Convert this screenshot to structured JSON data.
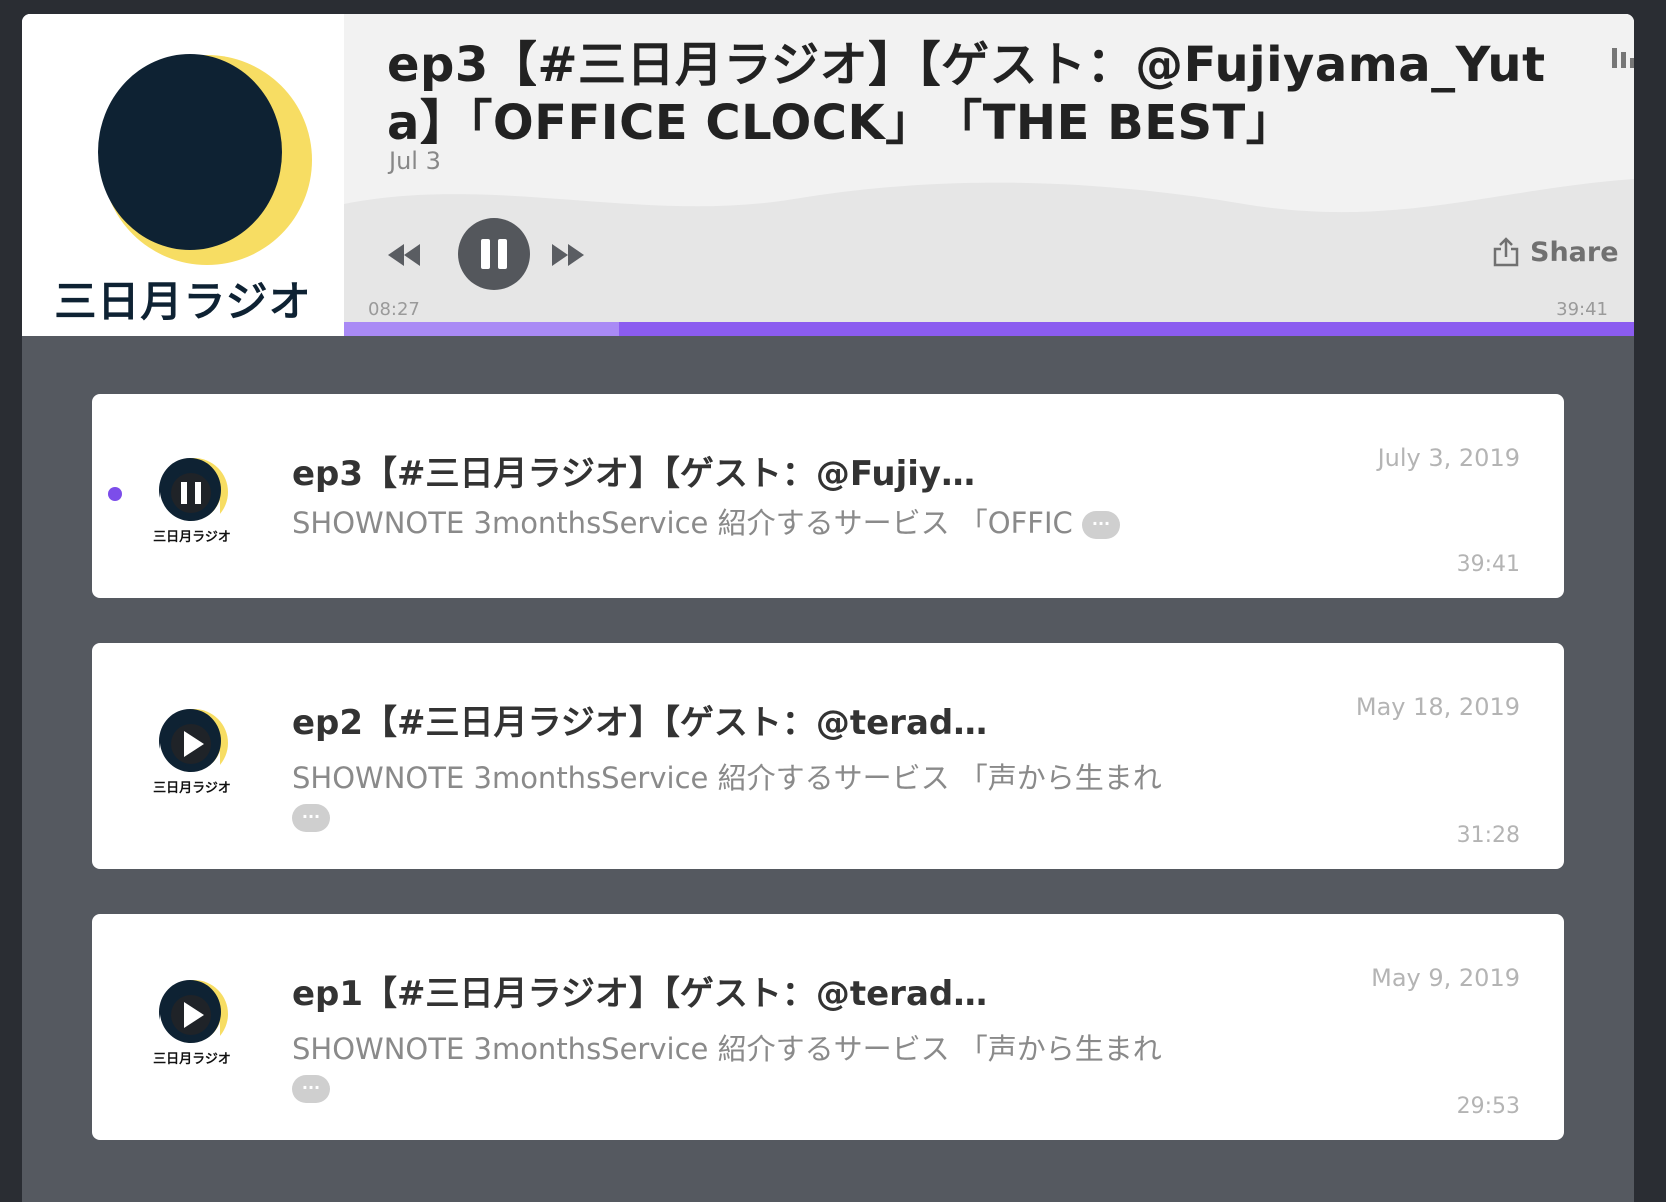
{
  "player": {
    "brand_label": "三日月ラジオ",
    "title": "ep3【#三日月ラジオ】【ゲスト：@Fujiyama_Yuta】「OFFICE CLOCK」　「THE BEST」",
    "date": "Jul 3",
    "share_label": "Share",
    "current_time": "08:27",
    "duration": "39:41",
    "progress_fraction": 0.2128,
    "accent_color": "#8b5cf0",
    "progress_played_color": "#a98af5"
  },
  "episodes": [
    {
      "title": "ep3【#三日月ラジオ】【ゲスト：@Fujiy…",
      "description": "SHOWNOTE  3monthsService 紹介するサービス 「OFFIC",
      "date": "July 3, 2019",
      "duration": "39:41",
      "state": "playing",
      "thumb_label": "三日月ラジオ"
    },
    {
      "title": "ep2【#三日月ラジオ】【ゲスト：@terad…",
      "description": "SHOWNOTE  3monthsService 紹介するサービス 「声から生まれ",
      "date": "May 18, 2019",
      "duration": "31:28",
      "state": "paused",
      "thumb_label": "三日月ラジオ"
    },
    {
      "title": "ep1【#三日月ラジオ】【ゲスト：@terad…",
      "description": "SHOWNOTE  3monthsService 紹介するサービス 「声から生まれ",
      "date": "May 9, 2019",
      "duration": "29:53",
      "state": "paused",
      "thumb_label": "三日月ラジオ"
    }
  ],
  "more_label": "···",
  "icons": {
    "rewind": "rewind-icon",
    "pause": "pause-icon",
    "forward": "fast-forward-icon",
    "share": "share-icon",
    "menu": "bars-icon",
    "play": "play-icon"
  }
}
